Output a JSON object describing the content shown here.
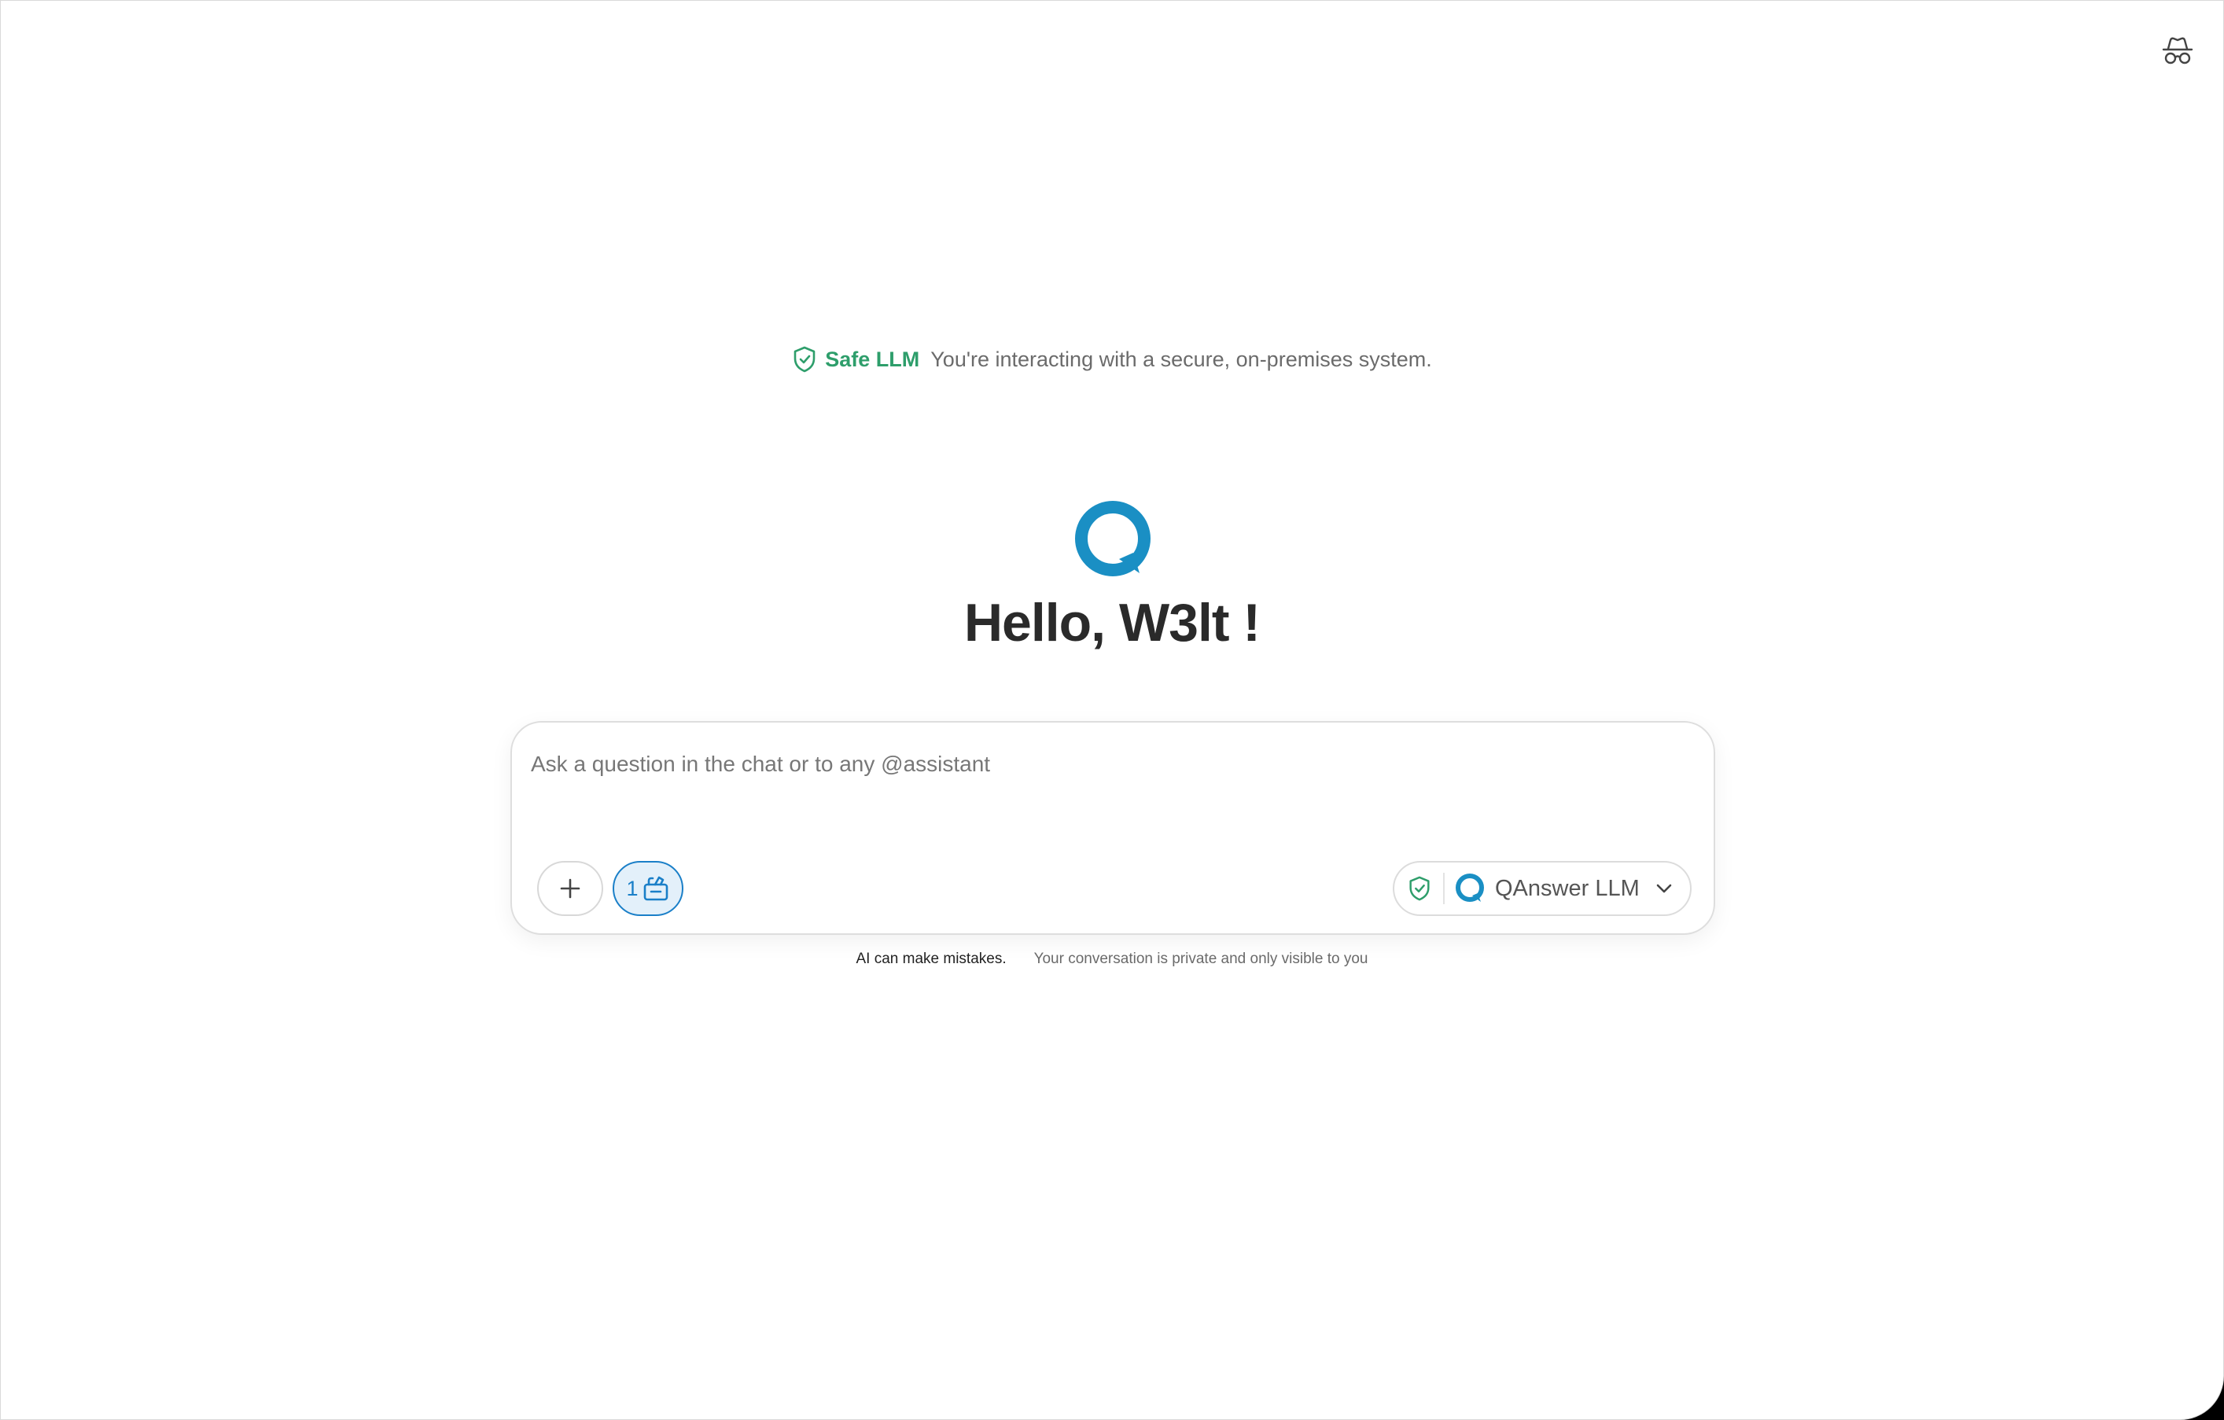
{
  "header": {
    "incognito_icon": "incognito-icon"
  },
  "banner": {
    "icon": "shield-check-icon",
    "title": "Safe LLM",
    "description": "You're interacting with a secure, on-premises system."
  },
  "hero": {
    "logo": "qanswer-logo",
    "greeting": "Hello, W3lt !"
  },
  "composer": {
    "placeholder": "Ask a question in the chat or to any @assistant",
    "value": "",
    "add_icon": "plus-icon",
    "assistant_count": "1",
    "assistant_icon": "toolbox-icon",
    "model": {
      "shield_icon": "shield-check-icon",
      "logo": "qanswer-logo",
      "name": "QAnswer LLM",
      "chevron": "chevron-down-icon"
    }
  },
  "footer": {
    "mistakes": "AI can make mistakes.",
    "privacy": "Your conversation is private and only visible to you"
  },
  "colors": {
    "accent_blue": "#1a8fc4",
    "safe_green": "#2e9e6b",
    "text_dark": "#2a2a2a",
    "text_muted": "#6b6b6b",
    "assist_bg": "#e3f0fa",
    "assist_border": "#1a7fc8"
  }
}
